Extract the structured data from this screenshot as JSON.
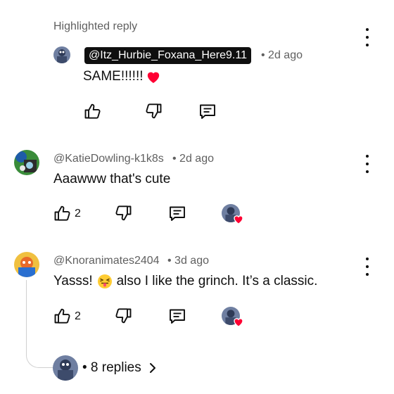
{
  "highlighted": {
    "title": "Highlighted reply",
    "handle": "@Itz_Hurbie_Foxana_Here9.11",
    "timestamp": "• 2d ago",
    "text": "SAME!!!!!!"
  },
  "comments": [
    {
      "handle": "@KatieDowling-k1k8s",
      "timestamp": "• 2d ago",
      "text": "Aaawww that's cute",
      "likes": "2"
    },
    {
      "handle": "@Knoranimates2404",
      "timestamp": "• 3d ago",
      "text_before": "Yasss!",
      "text_after": "also I like the grinch. It’s a classic.",
      "likes": "2"
    }
  ],
  "replies_link": "• 8 replies",
  "icons": {
    "like": "thumbs-up-icon",
    "dislike": "thumbs-down-icon",
    "reply": "reply-icon",
    "menu": "more-vert-icon",
    "heart": "heart-icon",
    "emoji": "squinting-tongue-emoji",
    "chevron": "chevron-right-icon"
  },
  "colors": {
    "heart": "#ff0033",
    "muted": "#606060",
    "text": "#0f0f0f"
  }
}
